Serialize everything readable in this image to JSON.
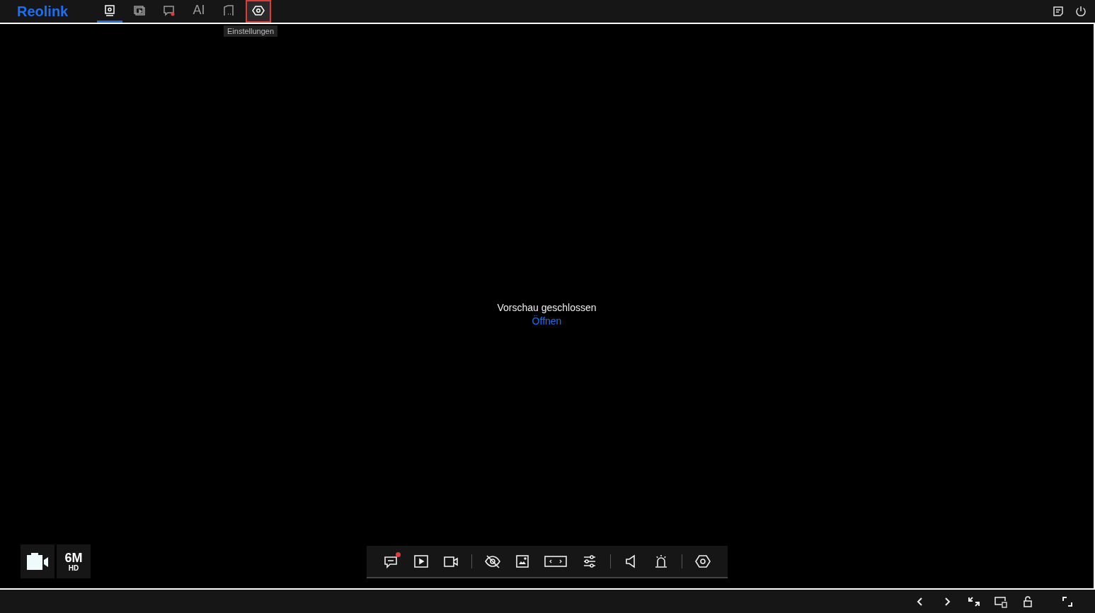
{
  "logo": "Reolink",
  "nav_tabs": [
    {
      "kind": "live",
      "selected": true,
      "hovered": false
    },
    {
      "kind": "playback",
      "selected": false,
      "hovered": false
    },
    {
      "kind": "alarm",
      "selected": false,
      "hovered": false
    },
    {
      "kind": "ai",
      "label": "AI",
      "selected": false,
      "hovered": false
    },
    {
      "kind": "files",
      "selected": false,
      "hovered": false
    },
    {
      "kind": "settings",
      "selected": false,
      "hovered": true
    }
  ],
  "tooltip": "Einstellungen",
  "top_right": [
    {
      "kind": "log"
    },
    {
      "kind": "power"
    }
  ],
  "preview": {
    "message": "Vorschau geschlossen",
    "link": "Öffnen"
  },
  "stream": {
    "resolution": "6M",
    "quality": "HD"
  },
  "toolbar": [
    {
      "kind": "chat",
      "notification": true
    },
    {
      "kind": "play",
      "notification": false
    },
    {
      "kind": "record",
      "notification": false
    },
    {
      "kind": "separator"
    },
    {
      "kind": "privacy",
      "notification": false
    },
    {
      "kind": "snapshot",
      "notification": false
    },
    {
      "kind": "aspect",
      "notification": false
    },
    {
      "kind": "adjust",
      "notification": false
    },
    {
      "kind": "separator"
    },
    {
      "kind": "speaker",
      "notification": false
    },
    {
      "kind": "siren",
      "notification": false
    },
    {
      "kind": "separator"
    },
    {
      "kind": "settings",
      "notification": false
    }
  ],
  "bottom_bar": [
    {
      "kind": "prev"
    },
    {
      "kind": "next"
    },
    {
      "kind": "sync"
    },
    {
      "kind": "screen"
    },
    {
      "kind": "lock"
    },
    {
      "kind": "fullscreen"
    }
  ]
}
